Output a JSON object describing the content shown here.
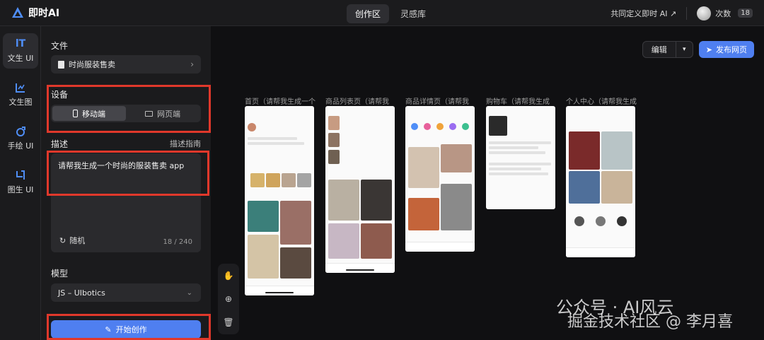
{
  "brand": {
    "name": "即时AI"
  },
  "nav": {
    "tabs": [
      {
        "label": "创作区"
      },
      {
        "label": "灵感库"
      }
    ]
  },
  "topright": {
    "define_link": "共同定义即时 AI ↗",
    "credits_label": "次数",
    "credits_value": "18"
  },
  "rail": {
    "items": [
      {
        "label": "文生 UI"
      },
      {
        "label": "文生图"
      },
      {
        "label": "手绘 UI"
      },
      {
        "label": "图生 UI"
      }
    ]
  },
  "panel": {
    "file_label": "文件",
    "file_value": "时尚服装售卖",
    "device_label": "设备",
    "device_mobile": "移动端",
    "device_web": "网页端",
    "desc_label": "描述",
    "desc_guide": "描述指南",
    "desc_value": "请帮我生成一个时尚的服装售卖 app",
    "random_label": "随机",
    "char_count": "18 / 240",
    "model_label": "模型",
    "model_value": "JS – UIbotics",
    "start_label": "开始创作"
  },
  "canvas": {
    "edit_label": "编辑",
    "publish_label": "发布网页",
    "screens": [
      {
        "title": "首页（请帮我生成一个"
      },
      {
        "title": "商品列表页（请帮我"
      },
      {
        "title": "商品详情页（请帮我"
      },
      {
        "title": "购物车（请帮我生成"
      },
      {
        "title": "个人中心（请帮我生成"
      }
    ]
  },
  "watermark": {
    "line1": "公众号 · AI风云",
    "line2": "掘金技术社区 @ 李月喜"
  },
  "colors": {
    "accent": "#4f7ff0",
    "highlight": "#e0382b"
  }
}
